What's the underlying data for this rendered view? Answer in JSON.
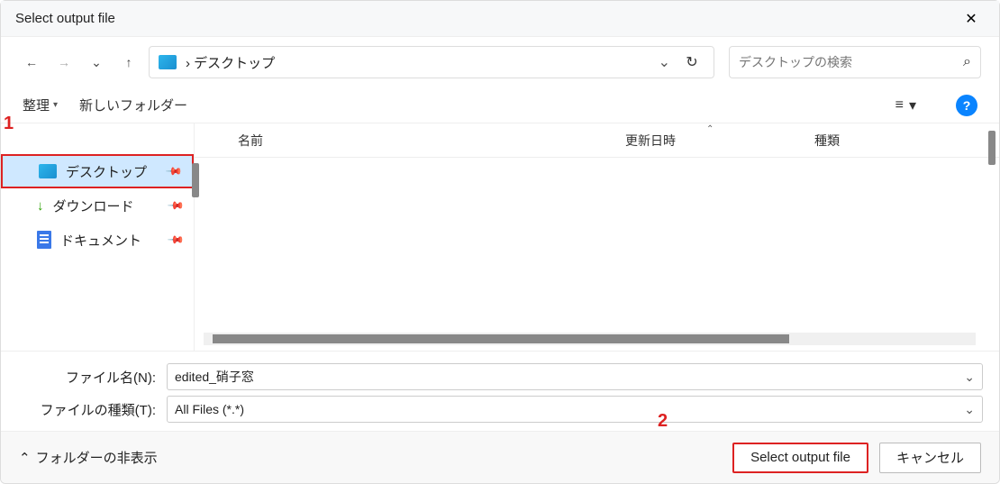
{
  "window": {
    "title": "Select output file"
  },
  "nav": {
    "breadcrumb": "›  デスクトップ"
  },
  "search": {
    "placeholder": "デスクトップの検索"
  },
  "toolbar": {
    "organize": "整理",
    "newfolder": "新しいフォルダー"
  },
  "columns": {
    "name": "名前",
    "date": "更新日時",
    "type": "種類"
  },
  "sidebar": {
    "items": [
      {
        "label": "デスクトップ"
      },
      {
        "label": "ダウンロード"
      },
      {
        "label": "ドキュメント"
      }
    ]
  },
  "filename": {
    "label": "ファイル名(N):",
    "value": "edited_硝子窓"
  },
  "filetype": {
    "label": "ファイルの種類(T):",
    "value": "All Files (*.*)"
  },
  "footer": {
    "foldertoggle": "フォルダーの非表示",
    "ok": "Select output file",
    "cancel": "キャンセル"
  },
  "annotations": {
    "one": "1",
    "two": "2"
  }
}
